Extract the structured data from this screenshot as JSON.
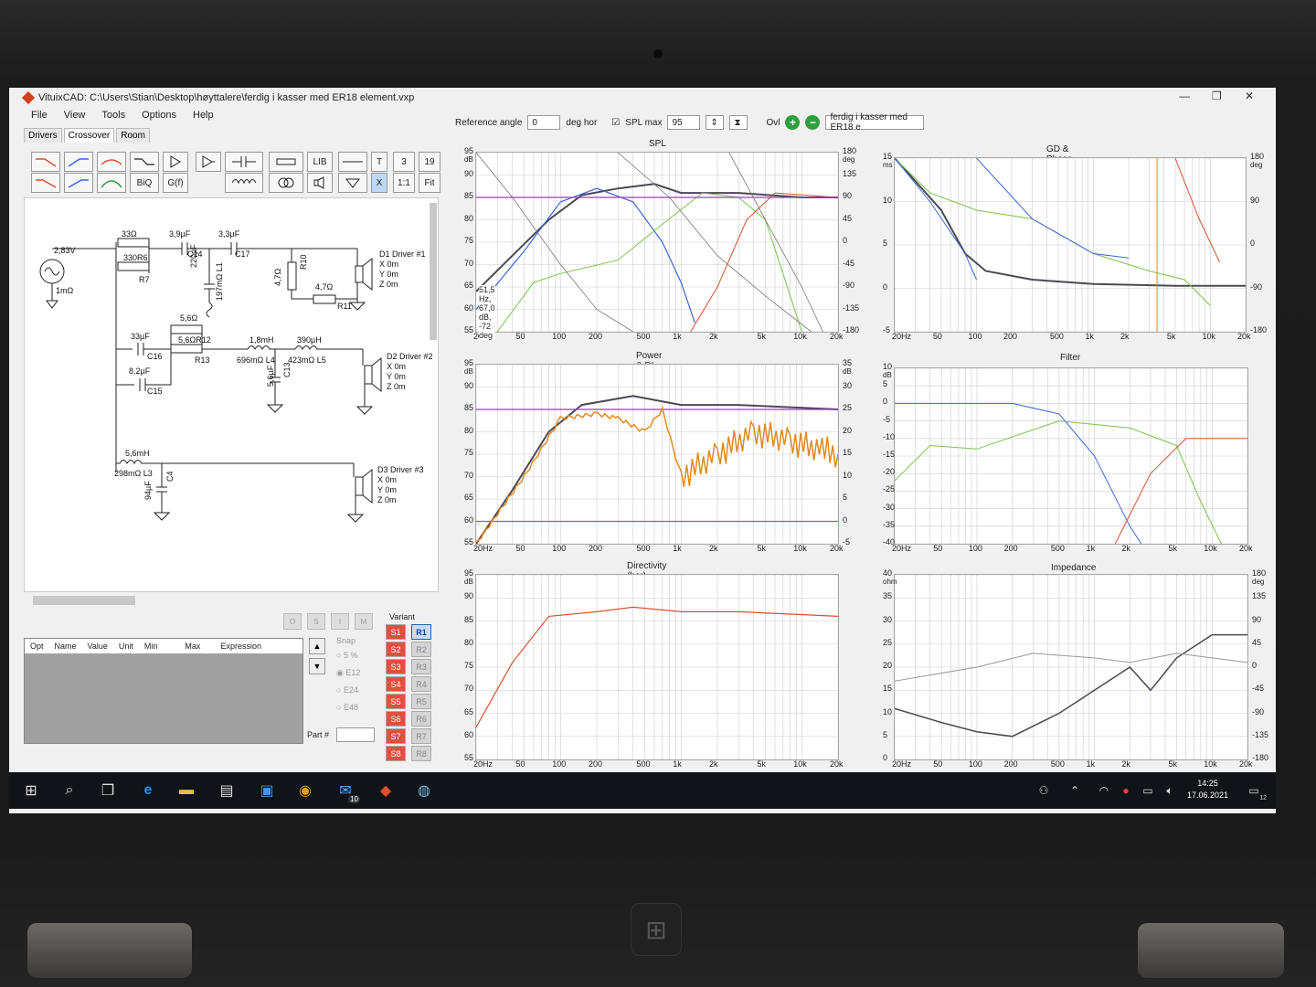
{
  "window": {
    "title": "VituixCAD: C:\\Users\\Stian\\Desktop\\høyttalere\\ferdig i kasser med ER18 element.vxp"
  },
  "menu": [
    "File",
    "View",
    "Tools",
    "Options",
    "Help"
  ],
  "tabs": [
    "Drivers",
    "Crossover",
    "Room"
  ],
  "toolbar": {
    "biq": "BiQ",
    "gf": "G(f)",
    "lib": "LIB",
    "t": "T",
    "num1": "3",
    "num2": "19",
    "x": "X",
    "ratio": "1:1",
    "fit": "Fit"
  },
  "top_controls": {
    "ref_angle_label": "Reference angle",
    "ref_angle_value": "0",
    "deg_hor": "deg hor",
    "spl_max_label": "SPL max",
    "spl_max_value": "95",
    "ovl": "Ovl",
    "project_field": "ferdig i kasser med ER18 e"
  },
  "schematic": {
    "labels": [
      {
        "t": "33Ω"
      },
      {
        "t": "3,9µF"
      },
      {
        "t": "3,3µF"
      },
      {
        "t": "2,83V"
      },
      {
        "t": "330R6"
      },
      {
        "t": "C14"
      },
      {
        "t": "C17"
      },
      {
        "t": "R7"
      },
      {
        "t": "220µF"
      },
      {
        "t": "197mΩ L1"
      },
      {
        "t": "1mΩ"
      },
      {
        "t": "R10"
      },
      {
        "t": "4,7Ω"
      },
      {
        "t": "4,7Ω"
      },
      {
        "t": "R11"
      },
      {
        "t": "D1 Driver #1"
      },
      {
        "t": "X 0m"
      },
      {
        "t": "Y 0m"
      },
      {
        "t": "Z 0m"
      },
      {
        "t": "5,6Ω"
      },
      {
        "t": "5,6ΩR12"
      },
      {
        "t": "R13"
      },
      {
        "t": "33µF"
      },
      {
        "t": "C16"
      },
      {
        "t": "8,2µF"
      },
      {
        "t": "C15"
      },
      {
        "t": "1,8mH"
      },
      {
        "t": "696mΩ L4"
      },
      {
        "t": "390µH"
      },
      {
        "t": "423mΩ L5"
      },
      {
        "t": "5,6µF"
      },
      {
        "t": "C13"
      },
      {
        "t": "D2 Driver #2"
      },
      {
        "t": "X 0m"
      },
      {
        "t": "Y 0m"
      },
      {
        "t": "Z 0m"
      },
      {
        "t": "5,6mH"
      },
      {
        "t": "298mΩ L3"
      },
      {
        "t": "94µF"
      },
      {
        "t": "C4"
      },
      {
        "t": "D3 Driver #3"
      },
      {
        "t": "X 0m"
      },
      {
        "t": "Y 0m"
      },
      {
        "t": "Z 0m"
      }
    ]
  },
  "optimizer": {
    "buttons": [
      "O",
      "S",
      "I",
      "M"
    ],
    "columns": [
      "Opt",
      "Name",
      "Value",
      "Unit",
      "Min",
      "Max",
      "Expression"
    ],
    "snap_label": "Snap",
    "snap_options": [
      "5 %",
      "E12",
      "E24",
      "E48"
    ],
    "part_label": "Part #",
    "variant_label": "Variant",
    "s_variants": [
      "S1",
      "S2",
      "S3",
      "S4",
      "S5",
      "S6",
      "S7",
      "S8"
    ],
    "r_variants": [
      "R1",
      "R2",
      "R3",
      "R4",
      "R5",
      "R6",
      "R7",
      "R8"
    ]
  },
  "plots": {
    "spl": {
      "title": "SPL",
      "y_unit": "dB",
      "y_ticks": [
        "95",
        "90",
        "85",
        "80",
        "75",
        "70",
        "65",
        "60",
        "55"
      ],
      "r_unit": "deg",
      "r_ticks": [
        "180",
        "135",
        "90",
        "45",
        "0",
        "-45",
        "-90",
        "-135",
        "-180"
      ],
      "x_ticks": [
        "20Hz",
        "50",
        "100",
        "200",
        "500",
        "1k",
        "2k",
        "5k",
        "10k",
        "20k"
      ],
      "readout": "51,5 Hz, 67,0 dB, -72 deg"
    },
    "gd": {
      "title": "GD & Phase",
      "y_unit": "ms",
      "y_ticks": [
        "15",
        "10",
        "5",
        "0",
        "-5"
      ],
      "r_unit": "deg",
      "r_ticks": [
        "180",
        "90",
        "0",
        "-90",
        "-180"
      ],
      "x_ticks": [
        "20Hz",
        "50",
        "100",
        "200",
        "500",
        "1k",
        "2k",
        "5k",
        "10k",
        "20k"
      ]
    },
    "power": {
      "title": "Power & DI",
      "y_unit": "dB",
      "y_ticks": [
        "95",
        "90",
        "85",
        "80",
        "75",
        "70",
        "65",
        "60",
        "55"
      ],
      "r_unit": "dB",
      "r_ticks": [
        "35",
        "30",
        "25",
        "20",
        "15",
        "10",
        "5",
        "0",
        "-5"
      ],
      "x_ticks": [
        "20Hz",
        "50",
        "100",
        "200",
        "500",
        "1k",
        "2k",
        "5k",
        "10k",
        "20k"
      ]
    },
    "filter": {
      "title": "Filter",
      "y_unit": "dB",
      "y_ticks": [
        "10",
        "5",
        "0",
        "-5",
        "-10",
        "-15",
        "-20",
        "-25",
        "-30",
        "-35",
        "-40"
      ],
      "x_ticks": [
        "20Hz",
        "50",
        "100",
        "200",
        "500",
        "1k",
        "2k",
        "5k",
        "10k",
        "20k"
      ]
    },
    "directivity": {
      "title": "Directivity (hor)",
      "y_unit": "dB",
      "y_ticks": [
        "95",
        "90",
        "85",
        "80",
        "75",
        "70",
        "65",
        "60",
        "55"
      ],
      "x_ticks": [
        "20Hz",
        "50",
        "100",
        "200",
        "500",
        "1k",
        "2k",
        "5k",
        "10k",
        "20k"
      ]
    },
    "impedance": {
      "title": "Impedance",
      "y_unit": "ohm",
      "y_ticks": [
        "40",
        "35",
        "30",
        "25",
        "20",
        "15",
        "10",
        "5",
        "0"
      ],
      "r_unit": "deg",
      "r_ticks": [
        "180",
        "135",
        "90",
        "45",
        "0",
        "-45",
        "-90",
        "-135",
        "-180"
      ],
      "x_ticks": [
        "20Hz",
        "50",
        "100",
        "200",
        "500",
        "1k",
        "2k",
        "5k",
        "10k",
        "20k"
      ]
    }
  },
  "taskbar": {
    "time": "14:25",
    "date": "17.06.2021",
    "mail_badge": "10",
    "notif_badge": "12"
  },
  "colors": {
    "blue": "#3a66d8",
    "green": "#7cc24a",
    "red": "#d8502e",
    "dark": "#4a4a55",
    "purple": "#9b3fb6",
    "orange": "#e08a1a"
  }
}
